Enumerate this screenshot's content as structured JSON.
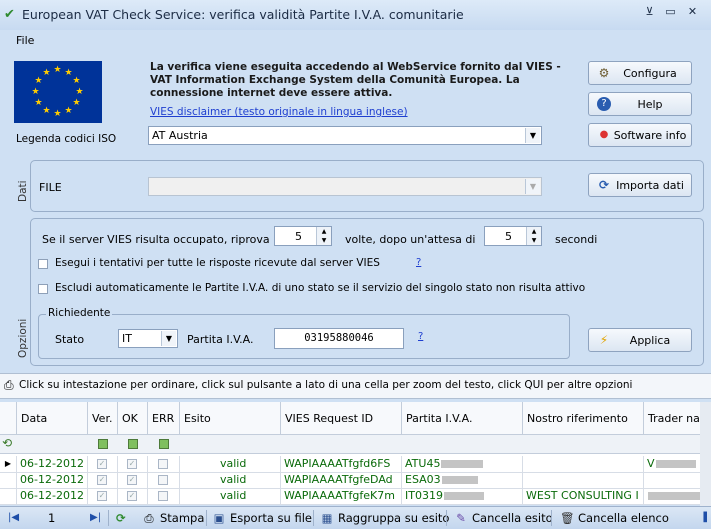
{
  "window": {
    "title": "European VAT Check Service: verifica validità Partite I.V.A. comunitarie",
    "controls": [
      "⊻",
      "▭",
      "✕"
    ]
  },
  "menu": {
    "file": "File"
  },
  "header": {
    "description": "La verifica viene eseguita accedendo al WebService fornito dal VIES - VAT Information Exchange System della Comunità Europea. La connessione internet deve essere attiva.",
    "disclaimer_link": "VIES disclaimer (testo originale in lingua inglese)",
    "iso_legend_label": "Legenda codici ISO",
    "country_select": "AT Austria"
  },
  "buttons": {
    "configura": "Configura",
    "help": "Help",
    "software_info": "Software info",
    "importa_dati": "Importa dati",
    "applica": "Applica"
  },
  "dati": {
    "group_label": "Dati",
    "file_label": "FILE",
    "file_value": ""
  },
  "opzioni": {
    "group_label": "Opzioni",
    "retry_prefix": "Se il server VIES risulta occupato, riprova",
    "retry_count": "5",
    "retry_middle": "volte, dopo un'attesa di",
    "wait_seconds": "5",
    "retry_suffix": "secondi",
    "option1": "Esegui i tentativi per tutte le risposte ricevute dal server VIES",
    "option1_help": "?",
    "option2": "Escludi automaticamente le Partite I.V.A. di uno stato se il servizio del singolo stato non risulta attivo",
    "richiedente_label": "Richiedente",
    "stato_label": "Stato",
    "stato_value": "IT",
    "partita_label": "Partita I.V.A.",
    "partita_value": "03195880046",
    "partita_help": "?"
  },
  "grid": {
    "info_bar": "Click su intestazione per ordinare, click sul pulsante a lato di una cella per zoom del testo, click QUI per altre opzioni",
    "columns": [
      "Data",
      "Ver.",
      "OK",
      "ERR",
      "Esito",
      "VIES Request ID",
      "Partita I.V.A.",
      "Nostro riferimento",
      "Trader name"
    ],
    "rows": [
      {
        "data": "06-12-2012",
        "esito": "valid",
        "request_id": "WAPIAAAATfgfd6FS",
        "partita": "ATU45",
        "riferimento": "",
        "trader": "V"
      },
      {
        "data": "06-12-2012",
        "esito": "valid",
        "request_id": "WAPIAAAATfgfeDAd",
        "partita": "ESA03",
        "riferimento": "",
        "trader": ""
      },
      {
        "data": "06-12-2012",
        "esito": "valid",
        "request_id": "WAPIAAAATfgfeK7m",
        "partita": "IT0319",
        "riferimento": "WEST CONSULTING I",
        "trader": ""
      }
    ]
  },
  "toolbar": {
    "page": "1",
    "stampa": "Stampa",
    "esporta": "Esporta su file",
    "raggruppa": "Raggruppa su esito",
    "cancella_esito": "Cancella esito",
    "cancella_elenco": "Cancella elenco"
  },
  "colors": {
    "background": "#cfe0f3",
    "valid_text": "#0a6a0a",
    "link": "#1f3fd0"
  }
}
